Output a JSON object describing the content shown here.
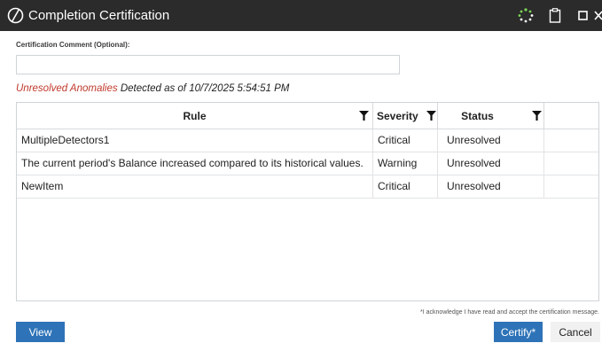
{
  "window": {
    "title": "Completion Certification",
    "icons": [
      "app-logo-icon",
      "loading-spinner-icon",
      "clipboard-icon",
      "maximize-icon",
      "close-icon"
    ]
  },
  "comment": {
    "label": "Certification Comment (Optional):",
    "value": "",
    "placeholder": ""
  },
  "anomalies": {
    "prefix": "Unresolved Anomalies",
    "suffix": "Detected as of 10/7/2025 5:54:51 PM",
    "prefix_color": "#c0392b"
  },
  "table": {
    "columns": [
      "Rule",
      "Severity",
      "Status"
    ],
    "rows": [
      {
        "rule": "MultipleDetectors1",
        "severity": "Critical",
        "status": "Unresolved"
      },
      {
        "rule": "The current period's Balance increased compared to its historical values.",
        "severity": "Warning",
        "status": "Unresolved"
      },
      {
        "rule": "NewItem",
        "severity": "Critical",
        "status": "Unresolved"
      }
    ]
  },
  "acknowledgement": "*I acknowledge I have read and accept the certification message.",
  "buttons": {
    "view": "View",
    "certify": "Certify*",
    "cancel": "Cancel"
  },
  "colors": {
    "titlebar": "#2b2b2b",
    "primary_button": "#2e73b8",
    "secondary_button": "#f1f1f1"
  }
}
